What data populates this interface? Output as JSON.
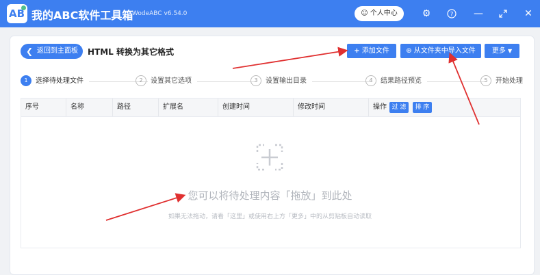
{
  "app": {
    "logo_text": "AB",
    "title": "我的ABC软件工具箱",
    "version": "WodeABC v6.54.0",
    "user_center": "个人中心"
  },
  "toolbar": {
    "back_label": "返回到主面板",
    "page_title": "HTML 转换为其它格式",
    "add_file": "添加文件",
    "import_from_folder": "从文件夹中导入文件",
    "more": "更多"
  },
  "steps": [
    {
      "num": "1",
      "label": "选择待处理文件"
    },
    {
      "num": "2",
      "label": "设置其它选项"
    },
    {
      "num": "3",
      "label": "设置输出目录"
    },
    {
      "num": "4",
      "label": "结果路径预览"
    },
    {
      "num": "5",
      "label": "开始处理"
    }
  ],
  "table": {
    "columns": [
      "序号",
      "名称",
      "路径",
      "扩展名",
      "创建时间",
      "修改时间",
      "操作"
    ],
    "filter_label": "过 滤",
    "sort_label": "排 序"
  },
  "empty_state": {
    "main": "您可以将待处理内容「拖放」到此处",
    "sub": "如果无法拖动，请看「这里」或使用右上方「更多」中的从剪贴板自动读取"
  },
  "icons": {
    "user": "user-icon",
    "settings": "gear-icon",
    "help": "question-icon",
    "minimize": "minimize-icon",
    "maximize": "maximize-icon",
    "close": "close-icon",
    "plus": "plus-icon",
    "folder_import": "circle-plus-icon",
    "chevron_down": "chevron-down-icon",
    "empty": "drop-area-icon"
  },
  "colors": {
    "accent": "#3d7ff0",
    "annotation": "#e03030"
  }
}
